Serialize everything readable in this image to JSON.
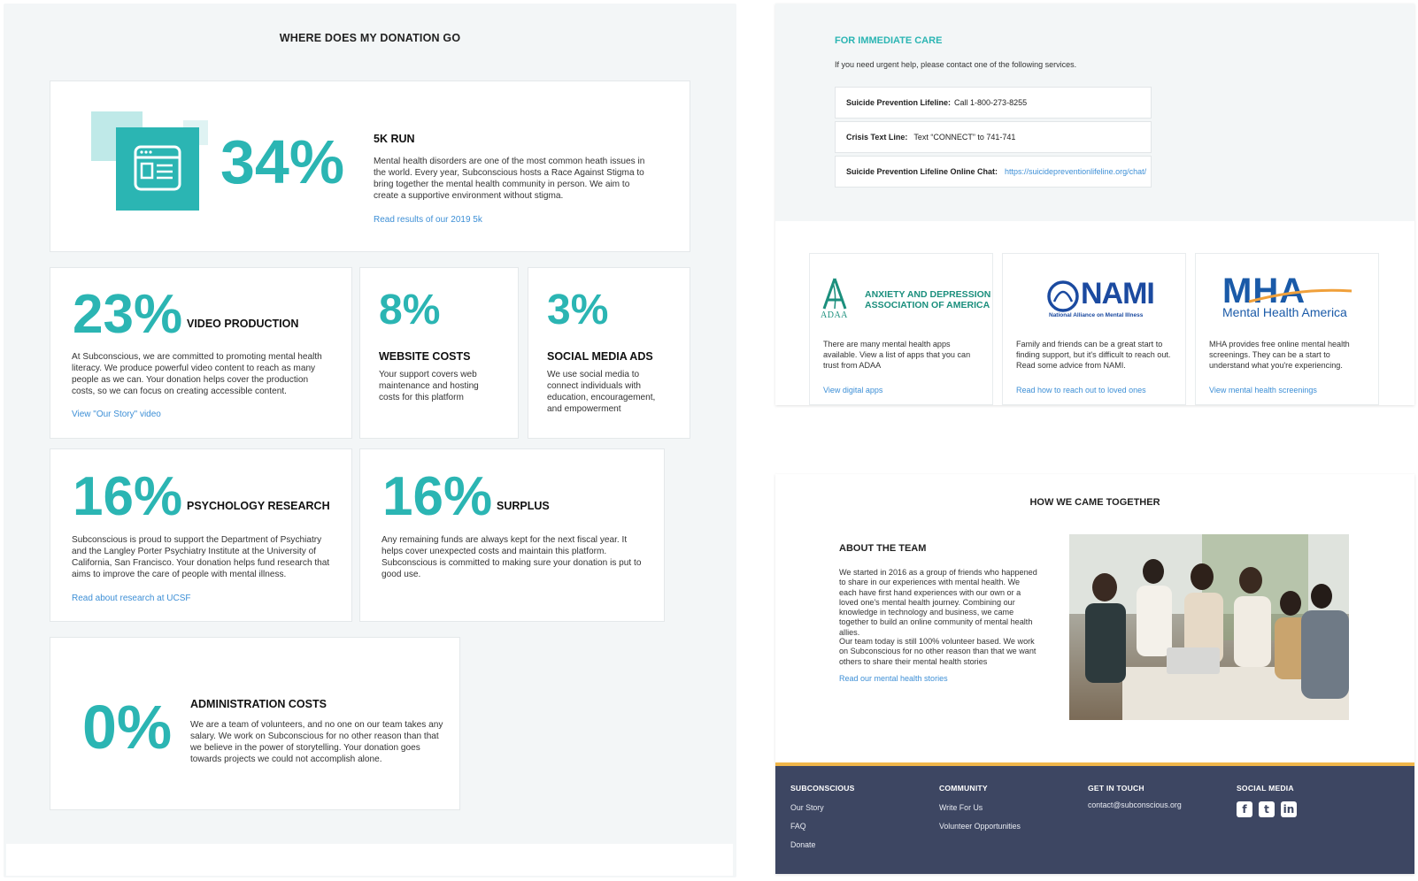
{
  "left": {
    "title": "WHERE DOES MY DONATION GO",
    "cards": [
      {
        "percent": "34%",
        "title": "5K RUN",
        "text": "Mental health disorders are one of the most common heath issues in the world. Every year, Subconscious hosts a Race Against Stigma to bring together the mental health community in person. We aim to create a supportive environment without stigma.",
        "link": "Read results of our 2019 5k"
      },
      {
        "percent": "23%",
        "title": "VIDEO PRODUCTION",
        "text": "At Subconscious, we are committed to promoting mental health literacy. We produce powerful video content to reach as many people as we can. Your donation helps cover the production costs, so we can focus on creating accessible content.",
        "link": "View \"Our Story\" video"
      },
      {
        "percent": "8%",
        "title": "WEBSITE COSTS",
        "text": "Your support covers web maintenance and hosting costs for this platform"
      },
      {
        "percent": "3%",
        "title": "SOCIAL MEDIA ADS",
        "text": "We use social media to connect individuals with education, encouragement, and empowerment"
      },
      {
        "percent": "16%",
        "title": "PSYCHOLOGY RESEARCH",
        "text": "Subconscious is proud to support the Department of Psychiatry and the Langley Porter Psychiatry Institute at the University of California, San Francisco. Your donation helps fund research that aims to improve the care of people with mental illness.",
        "link": "Read about research at UCSF"
      },
      {
        "percent": "16%",
        "title": "SURPLUS",
        "text": "Any remaining funds are always kept for the next fiscal year. It helps cover unexpected costs and maintain this platform. Subconscious is committed to making sure your donation is put to good use."
      },
      {
        "percent": "0%",
        "title": "ADMINISTRATION COSTS",
        "text": "We are a team of volunteers, and no one on our team takes any salary. We work on Subconscious for no other reason than that we believe in the power of storytelling. Your donation goes towards projects we could not accomplish alone."
      }
    ]
  },
  "care": {
    "title": "FOR IMMEDIATE CARE",
    "intro": "If you need urgent help, please contact one of the following services.",
    "rows": [
      {
        "label": "Suicide Prevention Lifeline:",
        "value": "Call 1-800-273-8255"
      },
      {
        "label": "Crisis Text Line:",
        "value": "Text “CONNECT” to 741-741"
      },
      {
        "label": "Suicide Prevention Lifeline Online Chat:",
        "value": "https://suicidepreventionlifeline.org/chat/"
      }
    ]
  },
  "orgs": [
    {
      "logo_abbr": "ADAA",
      "logo_name_1": "ANXIETY AND DEPRESSION",
      "logo_name_2": "ASSOCIATION OF AMERICA",
      "text": "There are many mental health apps available. View a list of apps that you can trust from ADAA",
      "link": "View digital apps"
    },
    {
      "logo_abbr": "NAMI",
      "logo_sub": "National Alliance on Mental Illness",
      "text": "Family and friends can be a great start to finding support, but it's difficult to reach out. Read some advice from NAMI.",
      "link": "Read how to reach out to loved ones"
    },
    {
      "logo_abbr": "MHA",
      "logo_sub": "Mental Health America",
      "text": "MHA provides free online mental health screenings. They can be a start to understand what you're experiencing.",
      "link": "View mental health screenings"
    }
  ],
  "team": {
    "section_title": "HOW WE CAME TOGETHER",
    "title": "ABOUT THE TEAM",
    "para1": "We started in 2016 as a group of friends who happened to share in our experiences with mental health. We each have first hand experiences with our own or a loved one's mental health journey. Combining our knowledge in technology and business, we came together to build an online community of mental health allies.",
    "para2": "Our team today is still 100% volunteer based. We work on Subconscious for no other reason than that we want others to share their mental health stories",
    "link": "Read our mental health stories"
  },
  "footer": {
    "col1": {
      "heading": "SUBCONSCIOUS",
      "items": [
        "Our Story",
        "FAQ",
        "Donate"
      ]
    },
    "col2": {
      "heading": "COMMUNITY",
      "items": [
        "Write For Us",
        "Volunteer Opportunities"
      ]
    },
    "col3": {
      "heading": "GET IN TOUCH",
      "email": "contact@subconscious.org"
    },
    "col4": {
      "heading": "SOCIAL MEDIA",
      "icons": [
        "facebook-icon",
        "twitter-icon",
        "linkedin-icon"
      ]
    }
  },
  "colors": {
    "accent": "#2bb5b3",
    "link": "#3d8fd6",
    "footer": "#3d4662",
    "footer_border": "#f0b64a",
    "panel": "#f3f6f7"
  }
}
